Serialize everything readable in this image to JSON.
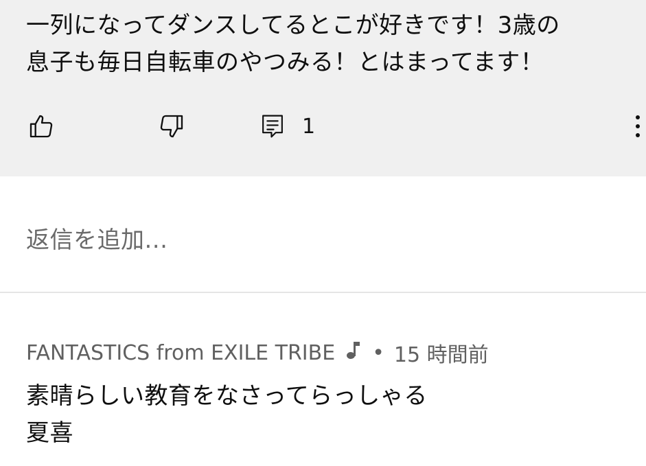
{
  "comment": {
    "text": "一列になってダンスしてるとこが好きです！3歳の\n息子も毎日自転車のやつみる！とはまってます！",
    "reply_count": "1",
    "icons": [
      "thumbs-up-icon",
      "thumbs-down-icon",
      "reply-icon",
      "more-vert-icon"
    ]
  },
  "reply_input": {
    "placeholder": "返信を追加..."
  },
  "reply": {
    "author": "FANTASTICS from EXILE TRIBE",
    "separator": "•",
    "time": "15 時間前",
    "text": "素晴らしい教育をなさってらっしゃる\n夏喜",
    "icons": [
      "music-note-icon"
    ]
  },
  "colors": {
    "card_background": "#f0f0f0",
    "text_primary": "#0f0f0f",
    "text_secondary": "#606060",
    "divider": "#e5e5e5"
  }
}
